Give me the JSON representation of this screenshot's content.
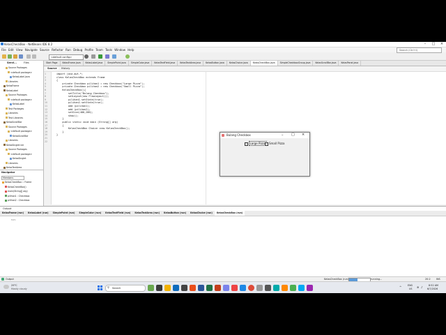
{
  "window": {
    "title": "KelasCheckBox - NetBeans IDE 8.2"
  },
  "menu": [
    "File",
    "Edit",
    "View",
    "Navigate",
    "Source",
    "Refactor",
    "Run",
    "Debug",
    "Profile",
    "Team",
    "Tools",
    "Window",
    "Help"
  ],
  "search": {
    "placeholder": "Search (Ctrl+I)"
  },
  "toolbar": {
    "config": "<default config>"
  },
  "left_tabs": [
    "Servi...",
    "Files"
  ],
  "tree": [
    {
      "label": "Source Packages",
      "indent": 2
    },
    {
      "label": "<default package>",
      "indent": 3
    },
    {
      "label": "KelasLabel.java",
      "indent": 4
    },
    {
      "label": "Libraries",
      "indent": 2
    },
    {
      "label": "KelasFrame",
      "indent": 1
    },
    {
      "label": "KelasLabel",
      "indent": 1
    },
    {
      "label": "Source Packages",
      "indent": 2
    },
    {
      "label": "<default package>",
      "indent": 3
    },
    {
      "label": "KelasLabel",
      "indent": 4
    },
    {
      "label": "Test Packages",
      "indent": 2
    },
    {
      "label": "Libraries",
      "indent": 2
    },
    {
      "label": "Test Libraries",
      "indent": 2
    },
    {
      "label": "KelasScrollBar",
      "indent": 1
    },
    {
      "label": "Source Packages",
      "indent": 2
    },
    {
      "label": "<default package>",
      "indent": 3
    },
    {
      "label": "KelasScrollBar",
      "indent": 4
    },
    {
      "label": "Libraries",
      "indent": 2
    },
    {
      "label": "KelasSinglet.txt",
      "indent": 1
    },
    {
      "label": "Source Packages",
      "indent": 2
    },
    {
      "label": "<default package>",
      "indent": 3
    },
    {
      "label": "KelasSinglet",
      "indent": 4
    },
    {
      "label": "Libraries",
      "indent": 2
    },
    {
      "label": "KelasTextArea",
      "indent": 1
    }
  ],
  "navigator": {
    "title": "Navigator",
    "filter": "Members",
    "items": [
      "KelasCheckBox :: Frame",
      "KelasCheckBox()",
      "main(String[] arg)",
      "pilihan1 : Checkbox",
      "pilihan2 : Checkbox"
    ]
  },
  "editor_tabs": [
    "Start Page",
    "KelasFrame.java",
    "KelasLabel.java",
    "SimplePoint.java",
    "SimpleColor.java",
    "KelasTextField.java",
    "KelasTextArea.java",
    "KelasButton.java",
    "KelasChoice.java",
    "KelasCheckBox.java",
    "SimpleCheckboxGroup.java",
    "KelasScrollBar.java",
    "KelasPanel.java"
  ],
  "active_editor_tab": 9,
  "editor_toolbar": {
    "source": "Source",
    "history": "History"
  },
  "code": [
    "import java.awt.*;",
    "class KelasCheckBox extends Frame",
    "{",
    "    private Checkbox pilihan1 = new Checkbox(\"Large Pizza\");",
    "    private Checkbox pilihan2 = new Checkbox(\"Small Pizza\");",
    "    KelasCheckBox(){",
    "        setTitle(\"Bulang Checkbox\");",
    "        setLayout(new FlowLayout());",
    "        pilihan1.setState(true);",
    "        pilihan2.setState(true);",
    "        add (pilihan1);",
    "        add (pilihan2);",
    "        setSize(400,200);",
    "        show();",
    "    }",
    "    public static void main (String[] arg)",
    "    {",
    "        KelasCheckBox Choice =new KelasCheckBox();",
    "    }",
    "}"
  ],
  "line_numbers": [
    "1",
    "2",
    "3",
    "4",
    "5",
    "6",
    "7",
    "8",
    "9",
    "10",
    "11",
    "12",
    "13",
    "14",
    "15",
    "16",
    "17",
    "18",
    "19",
    "20",
    "21",
    "22"
  ],
  "dialog": {
    "title": "Bulang Checkbox",
    "checkbox1": "Large Pizza",
    "checkbox2": "Small Pizza",
    "check_mark": "✓"
  },
  "output": {
    "title": "Output",
    "tabs": [
      "KelasFrame (run)",
      "KelasLabel (run)",
      "SimplePoint (run)",
      "SimpleColor (run)",
      "KelasTextField (run)",
      "KelasTextArea (run)",
      "KelasButton (run)",
      "KelasChoice (run)",
      "KelasCheckBox (run)"
    ],
    "active_tab": 8,
    "line": "run:"
  },
  "status": {
    "project": "KelasCheckBox (run)",
    "state": "running...",
    "pos": "20:2",
    "ins": "INS"
  },
  "taskbar": {
    "weather_temp": "29°C",
    "weather_desc": "Mostly cloudy",
    "search": "Search",
    "lang": "ENG",
    "region": "US",
    "time": "8:52 AM",
    "date": "6/7/2026"
  }
}
